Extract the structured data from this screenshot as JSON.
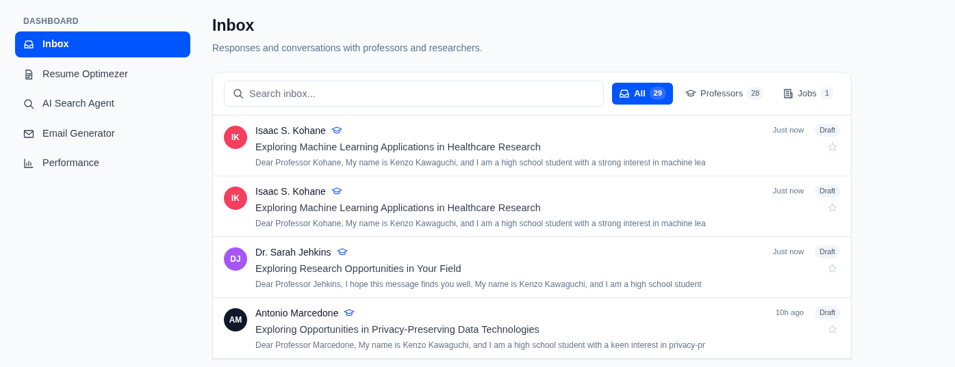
{
  "sidebar": {
    "heading": "DASHBOARD",
    "items": [
      {
        "label": "Inbox",
        "kind": "inbox",
        "selected": true
      },
      {
        "label": "Resume Optimezer",
        "kind": "document",
        "selected": false
      },
      {
        "label": "AI Search Agent",
        "kind": "search",
        "selected": false
      },
      {
        "label": "Email Generator",
        "kind": "mail",
        "selected": false
      },
      {
        "label": "Performance",
        "kind": "chart",
        "selected": false
      }
    ]
  },
  "page": {
    "title": "Inbox",
    "subtitle": "Responses and conversations with professors and researchers."
  },
  "search": {
    "placeholder": "Search inbox..."
  },
  "filters": [
    {
      "label": "All",
      "count": "29",
      "kind": "inbox",
      "selected": true
    },
    {
      "label": "Professors",
      "count": "28",
      "kind": "cap",
      "selected": false
    },
    {
      "label": "Jobs",
      "count": "1",
      "kind": "building",
      "selected": false
    }
  ],
  "messages": [
    {
      "initials": "IK",
      "color": "#f43f5e",
      "name": "Isaac S. Kohane",
      "professor": true,
      "subject": "Exploring Machine Learning Applications in Healthcare Research",
      "preview": "Dear Professor Kohane, My name is Kenzo Kawaguchi, and I am a high school student with a strong interest in machine lea",
      "time": "Just now",
      "badge": "Draft",
      "starred": false
    },
    {
      "initials": "IK",
      "color": "#f43f5e",
      "name": "Isaac S. Kohane",
      "professor": true,
      "subject": "Exploring Machine Learning Applications in Healthcare Research",
      "preview": "Dear Professor Kohane, My name is Kenzo Kawaguchi, and I am a high school student with a strong interest in machine lea",
      "time": "Just now",
      "badge": "Draft",
      "starred": false
    },
    {
      "initials": "DJ",
      "color": "#a855f7",
      "name": "Dr. Sarah Jehkins",
      "professor": true,
      "subject": "Exploring Research Opportunities in Your Field",
      "preview": "Dear Professor Jehkins, I hope this message finds you well. My name is Kenzo Kawaguchi, and I am a high school student",
      "time": "Just now",
      "badge": "Draft",
      "starred": false
    },
    {
      "initials": "AM",
      "color": "#0f172a",
      "name": "Antonio Marcedone",
      "professor": true,
      "subject": "Exploring Opportunities in Privacy-Preserving Data Technologies",
      "preview": "Dear Professor Marcedone, My name is Kenzo Kawaguchi, and I am a high school student with a keen interest in privacy-pr",
      "time": "10h ago",
      "badge": "Draft",
      "starred": false
    }
  ]
}
